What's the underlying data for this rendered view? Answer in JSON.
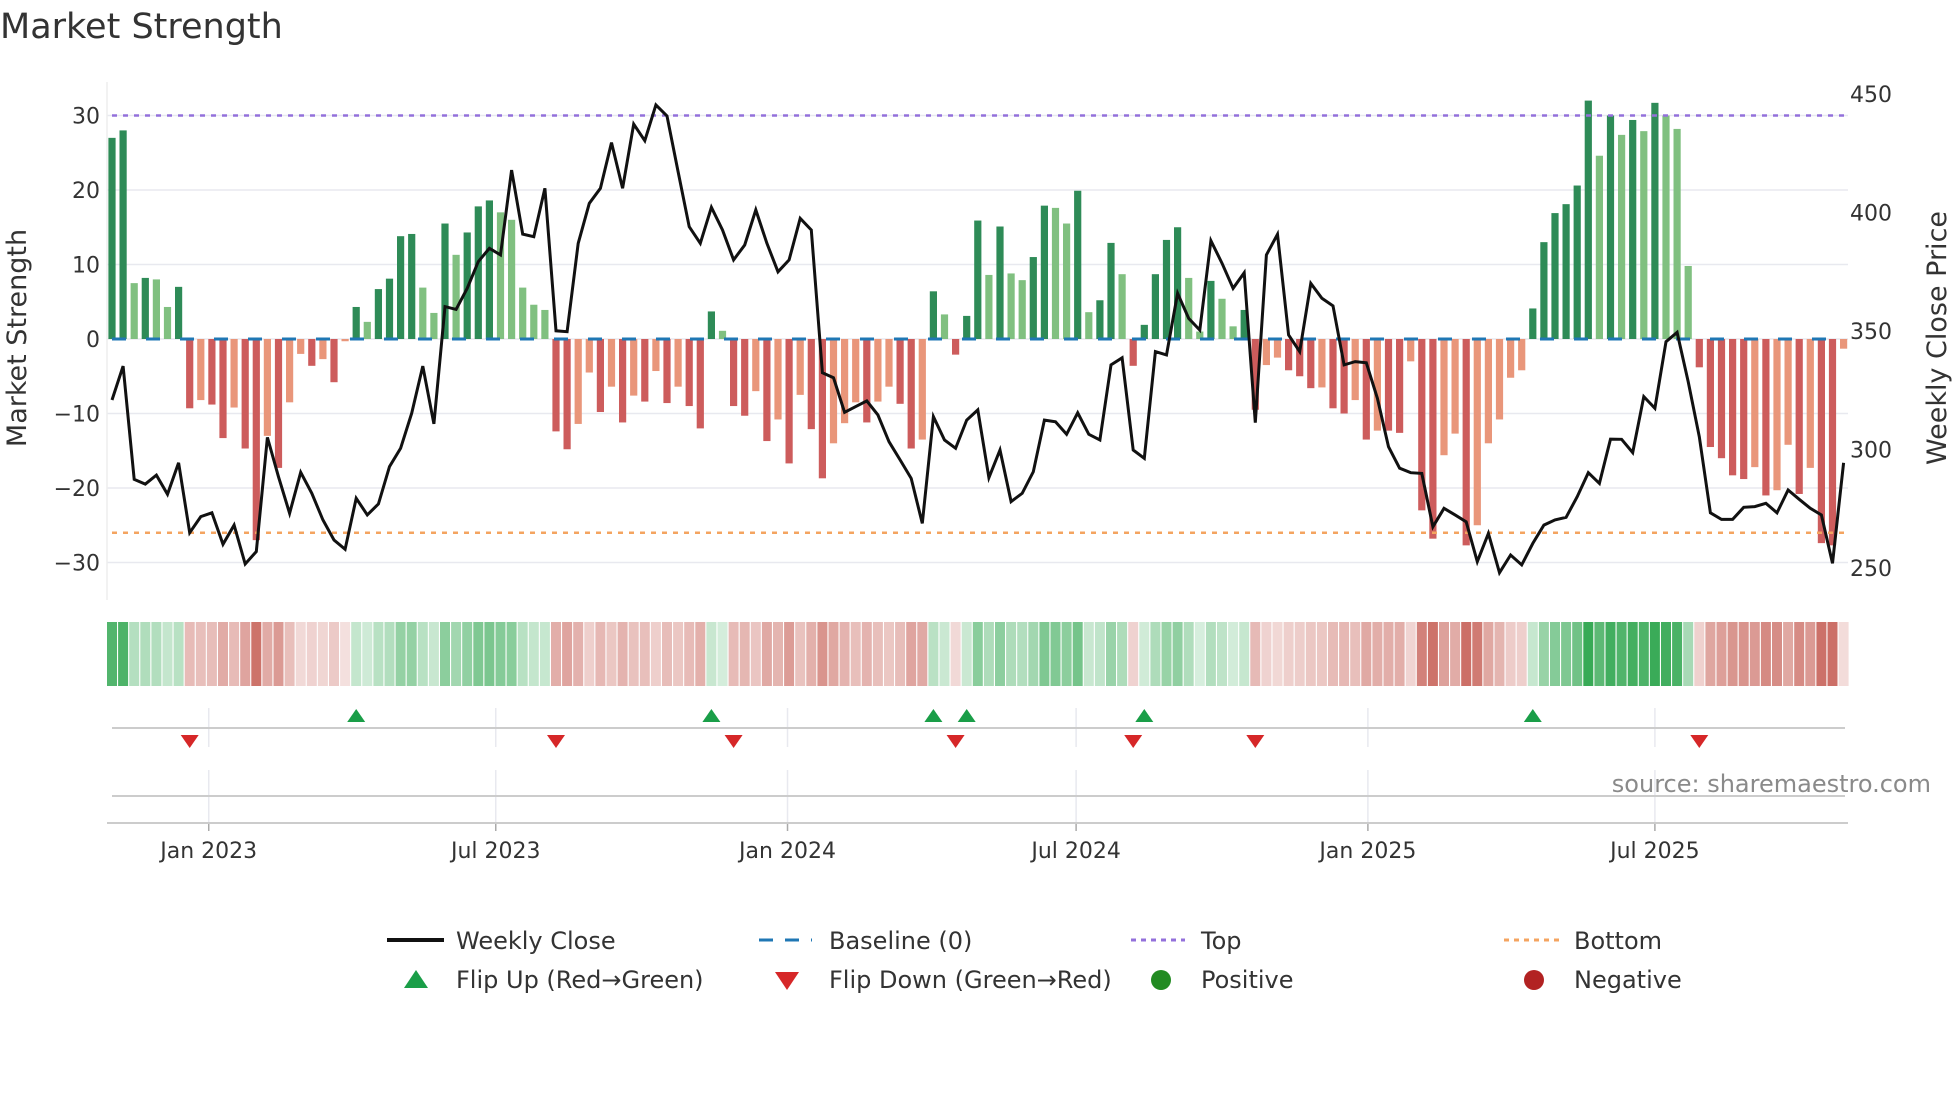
{
  "chart_data": {
    "type": "bar+line",
    "title": "Market Strength",
    "ylabel": "Market Strength",
    "y2label": "Weekly Close Price",
    "ylim": [
      -34,
      35
    ],
    "y2lim": [
      241,
      466
    ],
    "yticks": [
      30,
      20,
      10,
      0,
      -10,
      -20,
      -30
    ],
    "ytick_labels": [
      "30",
      "20",
      "10",
      "0",
      "−10",
      "−20",
      "−30"
    ],
    "y2ticks": [
      450,
      400,
      350,
      300,
      250
    ],
    "y2tick_labels": [
      "450",
      "400",
      "350",
      "300",
      "250"
    ],
    "x_start": "2022-11-01",
    "x_step_days": 7,
    "xticks": [
      {
        "date": "2023-01-01",
        "label": "Jan 2023"
      },
      {
        "date": "2023-07-01",
        "label": "Jul 2023"
      },
      {
        "date": "2024-01-01",
        "label": "Jan 2024"
      },
      {
        "date": "2024-07-01",
        "label": "Jul 2024"
      },
      {
        "date": "2025-01-01",
        "label": "Jan 2025"
      },
      {
        "date": "2025-07-01",
        "label": "Jul 2025"
      }
    ],
    "top_level": 30,
    "bottom_level": -26,
    "baseline": 0,
    "strength": [
      27,
      28,
      7.5,
      8.2,
      8,
      4.3,
      7,
      -9.3,
      -8.2,
      -8.8,
      -13.3,
      -9.2,
      -14.7,
      -27,
      -13,
      -17.3,
      -8.5,
      -2,
      -3.6,
      -2.7,
      -5.8,
      -0.3,
      4.3,
      2.3,
      6.7,
      8.1,
      13.8,
      14.1,
      6.9,
      3.5,
      15.5,
      11.3,
      14.3,
      17.8,
      18.6,
      17,
      16,
      6.9,
      4.6,
      3.9,
      -12.4,
      -14.8,
      -11.4,
      -4.5,
      -9.8,
      -6.4,
      -11.2,
      -7.6,
      -8.4,
      -4.3,
      -8.6,
      -6.4,
      -9,
      -12,
      3.7,
      1.1,
      -9,
      -10.3,
      -7,
      -13.7,
      -10.8,
      -16.7,
      -7.5,
      -12.1,
      -18.7,
      -14,
      -11.3,
      -8.5,
      -11.2,
      -8.4,
      -6.4,
      -8.7,
      -14.7,
      -13.5,
      6.4,
      3.3,
      -2.1,
      3.1,
      15.9,
      8.6,
      15.1,
      8.8,
      7.9,
      11,
      17.9,
      17.6,
      15.5,
      19.9,
      3.6,
      5.2,
      12.9,
      8.7,
      -3.6,
      1.9,
      8.7,
      13.3,
      15,
      8.2,
      1,
      7.8,
      5.4,
      1.7,
      3.9,
      -9.5,
      -3.5,
      -2.5,
      -4.2,
      -5,
      -6.6,
      -6.5,
      -9.3,
      -10,
      -8.2,
      -13.5,
      -12.3,
      -12.3,
      -12.6,
      -3,
      -23,
      -26.8,
      -15.6,
      -12.7,
      -27.7,
      -25,
      -14,
      -10.8,
      -5.2,
      -4.2,
      4.1,
      13,
      16.9,
      18.1,
      20.6,
      32,
      24.6,
      30,
      27.4,
      29.4,
      27.9,
      31.7,
      30,
      28.2,
      9.8,
      -3.8,
      -14.5,
      -16,
      -18.3,
      -18.8,
      -17.2,
      -21,
      -20.3,
      -14.2,
      -20.8,
      -17.3,
      -27.4,
      -27.7,
      -1.3
    ],
    "weekly_close": [
      320.9,
      335.2,
      287.4,
      285.4,
      289.2,
      281.1,
      294.4,
      264.9,
      271.7,
      273.3,
      260,
      268.1,
      251.7,
      256.9,
      305.1,
      288.5,
      273.1,
      290.4,
      281.5,
      270.3,
      261.8,
      257.9,
      279.4,
      272.4,
      277,
      292.8,
      300.5,
      315.3,
      335.2,
      310.8,
      360.3,
      359.1,
      368,
      379.3,
      384.9,
      382.1,
      417.9,
      390.9,
      389.8,
      410.2,
      350.1,
      349.7,
      387,
      403.9,
      410.2,
      429.5,
      410.2,
      437.3,
      430.3,
      445.4,
      440.7,
      417.2,
      394,
      387,
      402.2,
      392.6,
      380,
      386.3,
      401.1,
      387,
      375,
      380,
      397.5,
      392.6,
      332.4,
      330.3,
      315.7,
      318.1,
      320.5,
      314.6,
      303.3,
      295.6,
      287.8,
      268.8,
      313.9,
      304,
      300.5,
      312.4,
      316.7,
      288.1,
      299.8,
      278,
      281.5,
      290.6,
      312.4,
      311.7,
      306.4,
      315.5,
      306.4,
      304,
      335.7,
      338.7,
      299.8,
      296.3,
      341.3,
      339.9,
      365.9,
      355.3,
      350.4,
      388.1,
      378.6,
      368,
      374.6,
      311.3,
      382.1,
      390.8,
      348.3,
      341.3,
      370.1,
      363.8,
      360.6,
      335.7,
      337.1,
      336.6,
      321.6,
      301.2,
      292.1,
      290.2,
      289.9,
      267.4,
      275.2,
      272.4,
      269.5,
      252.7,
      264.6,
      248,
      255.5,
      251.3,
      260.4,
      268.1,
      270.3,
      271.4,
      280.1,
      290.2,
      285.7,
      304.4,
      304.3,
      298.7,
      322.3,
      317.4,
      345.5,
      349.4,
      328.6,
      305.4,
      273.3,
      270.5,
      270.5,
      275.6,
      275.9,
      277.3,
      273.3,
      282.9,
      279,
      275.2,
      272.4,
      252,
      294.4
    ],
    "legend": {
      "placement": "bottom-center",
      "weekly_close": "Weekly Close",
      "baseline": "Baseline (0)",
      "top": "Top",
      "bottom": "Bottom",
      "flip_up": "Flip Up (Red→Green)",
      "flip_down": "Flip Down (Green→Red)",
      "positive": "Positive",
      "negative": "Negative"
    },
    "source": "source: sharemaestro.com",
    "colors": {
      "pos_strong": "#2e8b57",
      "pos_weak": "#80c080",
      "neg_strong": "#cd5c5c",
      "neg_weak": "#e9967a",
      "strip_pos": "#34a853",
      "strip_neg": "#c45a50",
      "line": "#111111",
      "baseline": "#1f77b4",
      "top": "#9370db",
      "bottom": "#f4a460",
      "flip_up": "#1a9e48",
      "flip_down": "#d62728",
      "positive_dot": "#228b22",
      "negative_dot": "#b22222",
      "grid": "#e8e9ef",
      "axis": "#cccccc"
    }
  }
}
